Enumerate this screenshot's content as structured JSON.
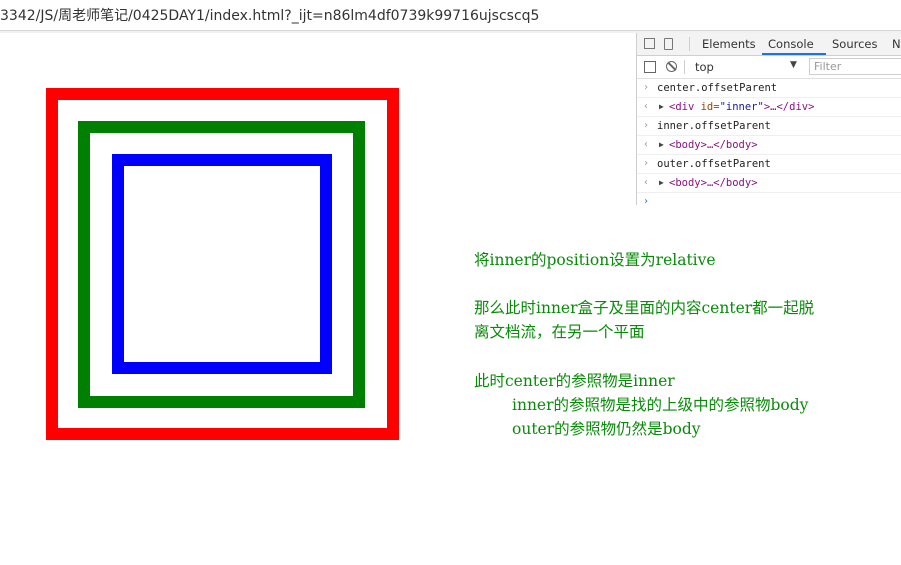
{
  "browser": {
    "url": "3342/JS/周老师笔记/0425DAY1/index.html?_ijt=n86lm4df0739k99716ujscscq5"
  },
  "devtools": {
    "tabs": [
      "Elements",
      "Console",
      "Sources",
      "N"
    ],
    "active_tab": "Console",
    "context": "top",
    "filter_placeholder": "Filter",
    "console": [
      {
        "type": "input",
        "gutter": "›",
        "text": "center.offsetParent"
      },
      {
        "type": "output",
        "gutter": "‹",
        "open": "<div ",
        "attr": "id=",
        "value": "\"inner\"",
        "rest": ">…</div>"
      },
      {
        "type": "input",
        "gutter": "›",
        "text": "inner.offsetParent"
      },
      {
        "type": "output",
        "gutter": "‹",
        "open": "<body>",
        "rest": "…</body>"
      },
      {
        "type": "input",
        "gutter": "›",
        "text": "outer.offsetParent"
      },
      {
        "type": "output",
        "gutter": "‹",
        "open": "<body>",
        "rest": "…</body>"
      }
    ],
    "prompt": "›"
  },
  "colors": {
    "outer_border": "#ff0000",
    "center_border": "#008000",
    "inner_border": "#0000ff",
    "note_text": "#0a8a0a"
  },
  "notes": {
    "line1": "将inner的position设置为relative",
    "line2": "那么此时inner盒子及里面的内容center都一起脱",
    "line3": "离文档流，在另一个平面",
    "line4": "此时center的参照物是inner",
    "line5": "inner的参照物是找的上级中的参照物body",
    "line6": "outer的参照物仍然是body"
  }
}
